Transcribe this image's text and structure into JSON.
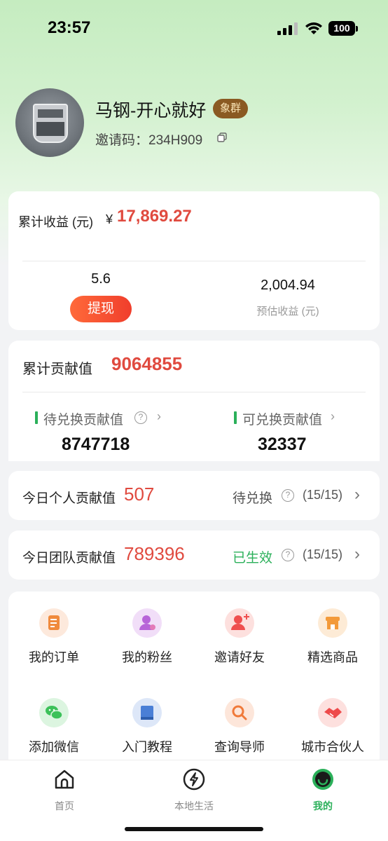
{
  "status_bar": {
    "time": "23:57",
    "battery": "100"
  },
  "profile": {
    "name": "马钢-开心就好",
    "level_badge": "象群",
    "invite_label": "邀请码：",
    "invite_code": "234H909"
  },
  "earnings": {
    "total_label": "累计收益 (元)",
    "currency_symbol": "¥",
    "total_value": "17,869.27",
    "withdrawable_amount": "5.6",
    "withdraw_button": "提现",
    "estimated_value": "2,004.94",
    "estimated_label": "预估收益 (元)"
  },
  "contribution": {
    "total_label": "累计贡献值",
    "total_value": "9064855",
    "pending_label": "待兑换贡献值",
    "pending_value": "8747718",
    "redeemable_label": "可兑换贡献值",
    "redeemable_value": "32337"
  },
  "today_personal": {
    "label": "今日个人贡献值",
    "value": "507",
    "status": "待兑换",
    "status_color": "#555555",
    "count": "(15/15)"
  },
  "today_team": {
    "label": "今日团队贡献值",
    "value": "789396",
    "status": "已生效",
    "status_color": "#2bb05a",
    "count": "(15/15)"
  },
  "grid": [
    {
      "label": "我的订单",
      "icon": "order-icon",
      "color": "#f08a3c"
    },
    {
      "label": "我的粉丝",
      "icon": "fans-icon",
      "color": "#b764d8"
    },
    {
      "label": "邀请好友",
      "icon": "invite-friend-icon",
      "color": "#ef4f4f"
    },
    {
      "label": "精选商品",
      "icon": "store-icon",
      "color": "#f39a3a"
    },
    {
      "label": "添加微信",
      "icon": "wechat-icon",
      "color": "#3cc159"
    },
    {
      "label": "入门教程",
      "icon": "tutorial-icon",
      "color": "#4a7fd6"
    },
    {
      "label": "查询导师",
      "icon": "search-mentor-icon",
      "color": "#f07a3a"
    },
    {
      "label": "城市合伙人",
      "icon": "handshake-icon",
      "color": "#ee4a4a"
    }
  ],
  "tabs": [
    {
      "label": "首页",
      "icon": "home-icon"
    },
    {
      "label": "本地生活",
      "icon": "lightning-icon"
    },
    {
      "label": "我的",
      "icon": "profile-icon",
      "active": true,
      "color": "#2bb05a"
    }
  ]
}
